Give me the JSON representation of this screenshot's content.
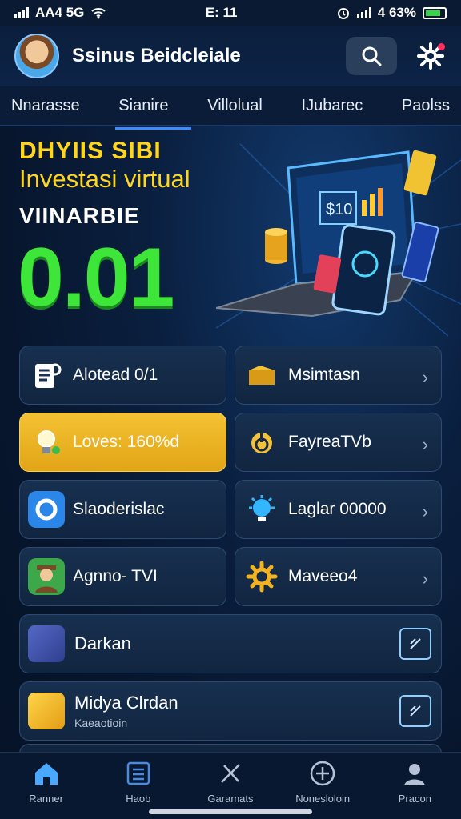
{
  "status_bar": {
    "carrier": "AA4 5G",
    "time": "E: 11",
    "battery": "4 63%"
  },
  "header": {
    "title": "Ssinus Beidcleiale"
  },
  "tabs": [
    {
      "label": "Nnarasse"
    },
    {
      "label": "Sianire"
    },
    {
      "label": "Villolual"
    },
    {
      "label": "IJubarec"
    },
    {
      "label": "Paolss"
    }
  ],
  "hero": {
    "promo": "DHYIIS SIBI",
    "subtitle": "Investasi virtual",
    "label": "VIINARBIE",
    "amount": "0.01",
    "screen_value": "$10"
  },
  "cards": [
    [
      {
        "label": "Alotead 0/1",
        "icon": "document-icon"
      },
      {
        "label": "Msimtasn",
        "icon": "folder-icon"
      }
    ],
    [
      {
        "label": "Loves: 160%d",
        "icon": "lightbulb-icon"
      },
      {
        "label": "FayreaTVb",
        "icon": "power-icon"
      }
    ],
    [
      {
        "label": "Slaoderislac",
        "icon": "circle-icon"
      },
      {
        "label": "Laglar 00000",
        "icon": "bulb-settings-icon"
      }
    ],
    [
      {
        "label": "Agnno- TVI",
        "icon": "person-icon"
      },
      {
        "label": "Maveeo4",
        "icon": "gear-icon"
      }
    ]
  ],
  "wide_cards": [
    {
      "title": "Darkan",
      "subtitle": ""
    },
    {
      "title": "Midya Clrdan",
      "subtitle": "Kaeaotioin"
    }
  ],
  "bottom_nav": [
    {
      "label": "Ranner",
      "icon": "home-icon"
    },
    {
      "label": "Haob",
      "icon": "list-icon"
    },
    {
      "label": "Garamats",
      "icon": "tools-icon"
    },
    {
      "label": "Nonesloloin",
      "icon": "plus-circle-icon"
    },
    {
      "label": "Pracon",
      "icon": "person-icon"
    }
  ],
  "colors": {
    "accent": "#3b8cff",
    "promo_yellow": "#ffd51e",
    "amount_green": "#3ee63a",
    "gold_card": "#f4c233"
  }
}
